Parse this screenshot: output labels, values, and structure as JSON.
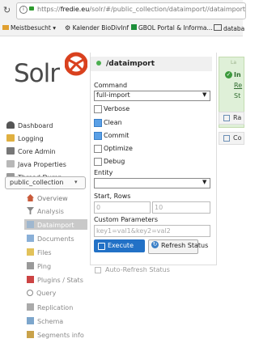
{
  "browser": {
    "url_prefix": "https://",
    "url_domain": "fredie.eu",
    "url_path": "/solr/#/public_collection/dataimport//dataimport",
    "bookmarks": [
      "Meistbesucht ▾",
      "Kalender BioDivInf",
      "GBOL Portal & Informa...",
      "databa"
    ]
  },
  "logo": {
    "text": "Solr"
  },
  "nav": {
    "items": [
      "Dashboard",
      "Logging",
      "Core Admin",
      "Java Properties",
      "Thread Dump"
    ],
    "core_selector": "public_collection",
    "core_items": [
      "Overview",
      "Analysis",
      "Dataimport",
      "Documents",
      "Files",
      "Ping",
      "Plugins / Stats",
      "Query",
      "Replication",
      "Schema",
      "Segments info"
    ]
  },
  "main": {
    "title": "/dataimport",
    "command_label": "Command",
    "command_value": "full-import",
    "options": [
      {
        "label": "Verbose",
        "checked": false
      },
      {
        "label": "Clean",
        "checked": true
      },
      {
        "label": "Commit",
        "checked": true
      },
      {
        "label": "Optimize",
        "checked": false
      },
      {
        "label": "Debug",
        "checked": false
      }
    ],
    "entity_label": "Entity",
    "entity_value": "",
    "start_rows_label": "Start, Rows",
    "start_placeholder": "0",
    "rows_placeholder": "10",
    "custom_params_label": "Custom Parameters",
    "custom_params_placeholder": "key1=val1&key2=val2",
    "execute_label": "Execute",
    "refresh_label": "Refresh Status",
    "auto_refresh_label": "Auto-Refresh Status"
  },
  "status": {
    "top_label": "La",
    "headline": "In",
    "line1": "Re",
    "line2": "St",
    "raw_label": "Ra",
    "config_label": "Co"
  },
  "colors": {
    "accent": "#2271c6",
    "status_green": "#4caf50",
    "logo_red": "#d9411e"
  }
}
